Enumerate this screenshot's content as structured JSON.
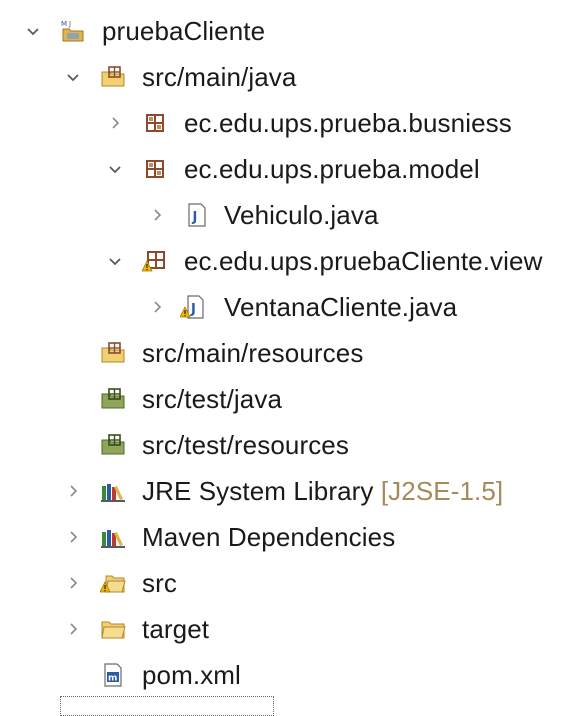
{
  "explorer": {
    "items": [
      {
        "label": "pruebaCliente",
        "decoration": "",
        "icon": "maven-project-icon",
        "expanded": true
      },
      {
        "label": "src/main/java",
        "decoration": "",
        "icon": "source-folder-icon",
        "expanded": true
      },
      {
        "label": "ec.edu.ups.prueba.busniess",
        "decoration": "",
        "icon": "package-icon",
        "expanded": false
      },
      {
        "label": "ec.edu.ups.prueba.model",
        "decoration": "",
        "icon": "package-icon",
        "expanded": true
      },
      {
        "label": "Vehiculo.java",
        "decoration": "",
        "icon": "java-file-icon",
        "expanded": false
      },
      {
        "label": "ec.edu.ups.pruebaCliente.view",
        "decoration": "",
        "icon": "package-warning-icon",
        "expanded": true
      },
      {
        "label": "VentanaCliente.java",
        "decoration": "",
        "icon": "java-file-warning-icon",
        "expanded": false
      },
      {
        "label": "src/main/resources",
        "decoration": "",
        "icon": "source-folder-icon",
        "expanded": null
      },
      {
        "label": "src/test/java",
        "decoration": "",
        "icon": "test-source-folder-icon",
        "expanded": null
      },
      {
        "label": "src/test/resources",
        "decoration": "",
        "icon": "test-source-folder-icon",
        "expanded": null
      },
      {
        "label": "JRE System Library",
        "decoration": "[J2SE-1.5]",
        "icon": "library-icon",
        "expanded": false
      },
      {
        "label": "Maven Dependencies",
        "decoration": "",
        "icon": "library-icon",
        "expanded": false
      },
      {
        "label": "src",
        "decoration": "",
        "icon": "folder-warning-icon",
        "expanded": false
      },
      {
        "label": "target",
        "decoration": "",
        "icon": "folder-icon",
        "expanded": false
      },
      {
        "label": "pom.xml",
        "decoration": "",
        "icon": "maven-pom-icon",
        "expanded": null
      }
    ]
  },
  "colors": {
    "chevron": "#5a5a5a",
    "package": "#8b4a2b",
    "folder": "#e0b44a",
    "test_folder": "#5f7a3a",
    "java_blue": "#2a5aa8",
    "warning": "#f2b705",
    "library_green": "#3a8a3a",
    "decoration": "#a58b5a"
  }
}
